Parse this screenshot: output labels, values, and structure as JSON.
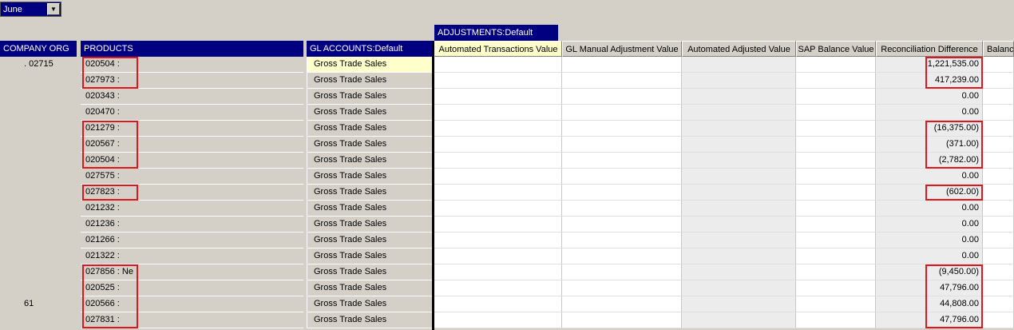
{
  "period_select": {
    "value": "June"
  },
  "adjustments_header": "ADJUSTMENTS:Default",
  "headers": {
    "company": "COMPANY ORG",
    "products": "PRODUCTS",
    "gl": "GL ACCOUNTS:Default",
    "auto_trans": "Automated Transactions Value",
    "gl_manual": "GL Manual Adjustment Value",
    "auto_adj": "Automated Adjusted Value",
    "sap_balance": "SAP Balance Value",
    "recon_diff": "Reconciliation Difference",
    "balance": "Balanc"
  },
  "companies": [
    {
      "label": ". 02715",
      "row": 0
    },
    {
      "label": "61",
      "row": 15
    }
  ],
  "rows": [
    {
      "product": "020504 :",
      "gl": "Gross Trade Sales",
      "recon": "1,221,535.00"
    },
    {
      "product": "027973 :",
      "gl": "Gross Trade Sales",
      "recon": "417,239.00"
    },
    {
      "product": "020343 :",
      "gl": "Gross Trade Sales",
      "recon": "0.00"
    },
    {
      "product": "020470 :",
      "gl": "Gross Trade Sales",
      "recon": "0.00"
    },
    {
      "product": "021279 :",
      "gl": "Gross Trade Sales",
      "recon": "(16,375.00)"
    },
    {
      "product": "020567 :",
      "gl": "Gross Trade Sales",
      "recon": "(371.00)"
    },
    {
      "product": "020504 :",
      "gl": "Gross Trade Sales",
      "recon": "(2,782.00)"
    },
    {
      "product": "027575 :",
      "gl": "Gross Trade Sales",
      "recon": "0.00"
    },
    {
      "product": "027823 :",
      "gl": "Gross Trade Sales",
      "recon": "(602.00)"
    },
    {
      "product": "021232 :",
      "gl": "Gross Trade Sales",
      "recon": "0.00"
    },
    {
      "product": "021236 :",
      "gl": "Gross Trade Sales",
      "recon": "0.00"
    },
    {
      "product": "021266 :",
      "gl": "Gross Trade Sales",
      "recon": "0.00"
    },
    {
      "product": "021322 :",
      "gl": "Gross Trade Sales",
      "recon": "0.00"
    },
    {
      "product": "027856 : Ne",
      "gl": "Gross Trade Sales",
      "recon": "(9,450.00)"
    },
    {
      "product": "020525 :",
      "gl": "Gross Trade Sales",
      "recon": "47,796.00"
    },
    {
      "product": "020566 :",
      "gl": "Gross Trade Sales",
      "recon": "44,808.00"
    },
    {
      "product": "027831 :",
      "gl": "Gross Trade Sales",
      "recon": "47,796.00"
    }
  ],
  "colors": {
    "header_blue": "#000080",
    "highlight_red": "#e0161c",
    "selected_yellow": "#ffffcc"
  }
}
